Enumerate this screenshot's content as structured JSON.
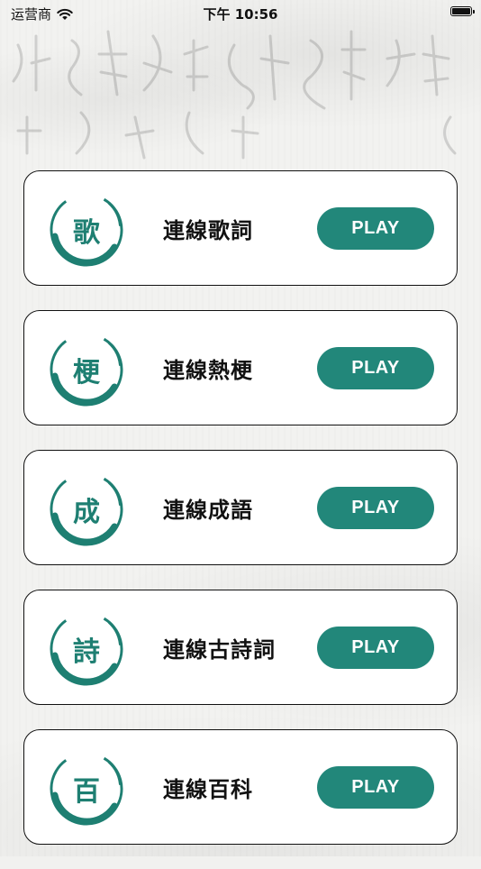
{
  "status_bar": {
    "carrier": "运营商",
    "time": "下午 10:56"
  },
  "games": [
    {
      "badge": "歌",
      "title": "連線歌詞",
      "play_label": "PLAY"
    },
    {
      "badge": "梗",
      "title": "連線熱梗",
      "play_label": "PLAY"
    },
    {
      "badge": "成",
      "title": "連線成語",
      "play_label": "PLAY"
    },
    {
      "badge": "詩",
      "title": "連線古詩詞",
      "play_label": "PLAY"
    },
    {
      "badge": "百",
      "title": "連線百科",
      "play_label": "PLAY"
    }
  ],
  "colors": {
    "accent": "#22877a",
    "badge_text": "#1e7f72",
    "card_bg": "#ffffff",
    "card_border": "#111111"
  }
}
